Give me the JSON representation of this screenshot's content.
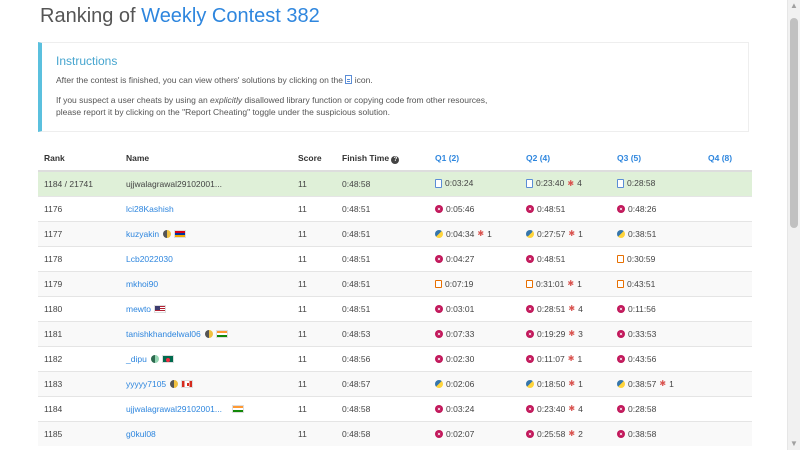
{
  "header": {
    "title_prefix": "Ranking of ",
    "contest_name": "Weekly Contest 382"
  },
  "instructions": {
    "title": "Instructions",
    "line1_before": "After the contest is finished, you can view others' solutions by clicking on the",
    "line1_after": "icon.",
    "line2_a": "If you suspect a user cheats by using an ",
    "line2_em": "explicitly",
    "line2_b": " disallowed library function or copying code from other resources,",
    "line3": "please report it by clicking on the \"Report Cheating\" toggle under the suspicious solution."
  },
  "table": {
    "headers": {
      "rank": "Rank",
      "name": "Name",
      "score": "Score",
      "finish": "Finish Time",
      "q1": "Q1 (2)",
      "q2": "Q2 (4)",
      "q3": "Q3 (5)",
      "q4": "Q4 (8)"
    },
    "rows": [
      {
        "rank": "1184 / 21741",
        "name": "ujjwalagrawal29102001...",
        "score": "11",
        "finish": "0:48:58",
        "q1": {
          "time": "0:03:24",
          "bugs": "",
          "lang": "doc"
        },
        "q2": {
          "time": "0:23:40",
          "bugs": "4",
          "lang": "doc"
        },
        "q3": {
          "time": "0:28:58",
          "bugs": "",
          "lang": "doc"
        }
      },
      {
        "rank": "1176",
        "name": "lci28Kashish",
        "score": "11",
        "finish": "0:48:51",
        "q1": {
          "time": "0:05:46",
          "bugs": "",
          "lang": "cpp"
        },
        "q2": {
          "time": "0:48:51",
          "bugs": "",
          "lang": "cpp"
        },
        "q3": {
          "time": "0:48:26",
          "bugs": "",
          "lang": "cpp"
        }
      },
      {
        "rank": "1177",
        "name": "kuzyakin",
        "score": "11",
        "finish": "0:48:51",
        "q1": {
          "time": "0:04:34",
          "bugs": "1",
          "lang": "py"
        },
        "q2": {
          "time": "0:27:57",
          "bugs": "1",
          "lang": "py"
        },
        "q3": {
          "time": "0:38:51",
          "bugs": "",
          "lang": "py"
        }
      },
      {
        "rank": "1178",
        "name": "Lcb2022030",
        "score": "11",
        "finish": "0:48:51",
        "q1": {
          "time": "0:04:27",
          "bugs": "",
          "lang": "cpp"
        },
        "q2": {
          "time": "0:48:51",
          "bugs": "",
          "lang": "cpp"
        },
        "q3": {
          "time": "0:30:59",
          "bugs": "",
          "lang": "java"
        }
      },
      {
        "rank": "1179",
        "name": "mkhoi90",
        "score": "11",
        "finish": "0:48:51",
        "q1": {
          "time": "0:07:19",
          "bugs": "",
          "lang": "java"
        },
        "q2": {
          "time": "0:31:01",
          "bugs": "1",
          "lang": "java"
        },
        "q3": {
          "time": "0:43:51",
          "bugs": "",
          "lang": "java"
        }
      },
      {
        "rank": "1180",
        "name": "mewto",
        "score": "11",
        "finish": "0:48:51",
        "q1": {
          "time": "0:03:01",
          "bugs": "",
          "lang": "cpp"
        },
        "q2": {
          "time": "0:28:51",
          "bugs": "4",
          "lang": "cpp"
        },
        "q3": {
          "time": "0:11:56",
          "bugs": "",
          "lang": "cpp"
        }
      },
      {
        "rank": "1181",
        "name": "tanishkhandelwal06",
        "score": "11",
        "finish": "0:48:53",
        "q1": {
          "time": "0:07:33",
          "bugs": "",
          "lang": "cpp"
        },
        "q2": {
          "time": "0:19:29",
          "bugs": "3",
          "lang": "cpp"
        },
        "q3": {
          "time": "0:33:53",
          "bugs": "",
          "lang": "cpp"
        }
      },
      {
        "rank": "1182",
        "name": "_dipu",
        "score": "11",
        "finish": "0:48:56",
        "q1": {
          "time": "0:02:30",
          "bugs": "",
          "lang": "cpp"
        },
        "q2": {
          "time": "0:11:07",
          "bugs": "1",
          "lang": "cpp"
        },
        "q3": {
          "time": "0:43:56",
          "bugs": "",
          "lang": "cpp"
        }
      },
      {
        "rank": "1183",
        "name": "yyyyy7105",
        "score": "11",
        "finish": "0:48:57",
        "q1": {
          "time": "0:02:06",
          "bugs": "",
          "lang": "py"
        },
        "q2": {
          "time": "0:18:50",
          "bugs": "1",
          "lang": "py"
        },
        "q3": {
          "time": "0:38:57",
          "bugs": "1",
          "lang": "py"
        }
      },
      {
        "rank": "1184",
        "name": "ujjwalagrawal29102001...",
        "score": "11",
        "finish": "0:48:58",
        "q1": {
          "time": "0:03:24",
          "bugs": "",
          "lang": "cpp"
        },
        "q2": {
          "time": "0:23:40",
          "bugs": "4",
          "lang": "cpp"
        },
        "q3": {
          "time": "0:28:58",
          "bugs": "",
          "lang": "cpp"
        }
      },
      {
        "rank": "1185",
        "name": "g0kul08",
        "score": "11",
        "finish": "0:48:58",
        "q1": {
          "time": "0:02:07",
          "bugs": "",
          "lang": "cpp"
        },
        "q2": {
          "time": "0:25:58",
          "bugs": "2",
          "lang": "cpp"
        },
        "q3": {
          "time": "0:38:58",
          "bugs": "",
          "lang": "cpp"
        }
      }
    ]
  },
  "colors": {
    "link": "#2e86de",
    "accent": "#5bc0de",
    "highlight_row": "#dff0d8",
    "bug": "#d9534f"
  }
}
